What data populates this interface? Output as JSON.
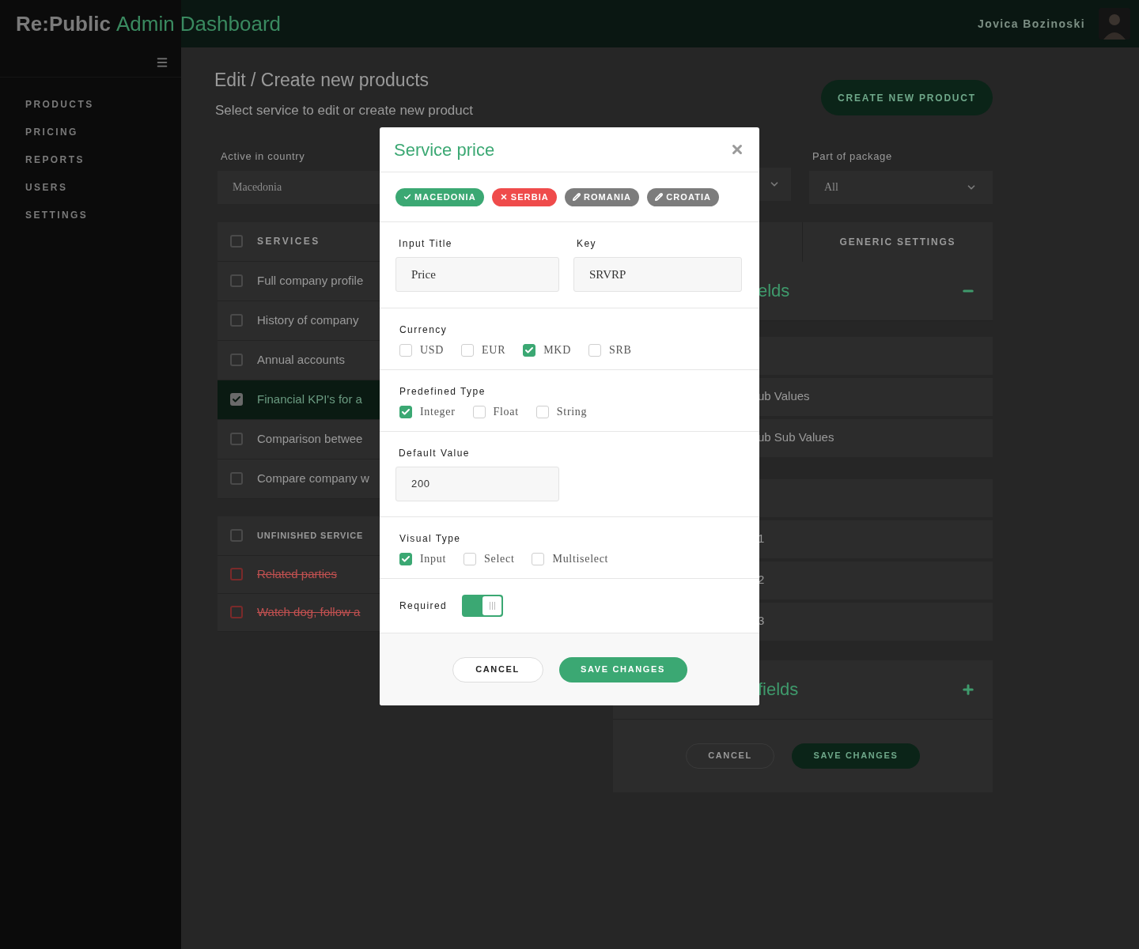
{
  "header": {
    "brand": "Re:Public",
    "brand_suffix": "Admin Dashboard",
    "user_name": "Jovica Bozinoski"
  },
  "sidebar": {
    "items": [
      {
        "label": "PRODUCTS"
      },
      {
        "label": "PRICING"
      },
      {
        "label": "REPORTS"
      },
      {
        "label": "USERS"
      },
      {
        "label": "SETTINGS"
      }
    ]
  },
  "page": {
    "title": "Edit / Create new products",
    "subtitle": "Select service to edit or create new product",
    "create_button": "CREATE NEW PRODUCT"
  },
  "filters": {
    "country": {
      "label": "Active in country",
      "value": "Macedonia"
    },
    "package": {
      "label": "Part of package",
      "value": "All"
    }
  },
  "services": {
    "header": "SERVICES",
    "header_checked": false,
    "rows": [
      {
        "label": "Full company profile",
        "checked": false,
        "selected": false
      },
      {
        "label": "History of company",
        "checked": false,
        "selected": false
      },
      {
        "label": "Annual accounts",
        "checked": false,
        "selected": false
      },
      {
        "label": "Financial KPI's for a",
        "checked": true,
        "selected": true
      },
      {
        "label": "Comparison betwee",
        "checked": false,
        "selected": false
      },
      {
        "label": "Compare company w",
        "checked": false,
        "selected": false
      }
    ]
  },
  "unfinished": {
    "header": "UNFINISHED SERVICE",
    "header_checked": false,
    "rows": [
      {
        "label": "Related parties",
        "checked": false
      },
      {
        "label": "Watch dog, follow a",
        "checked": false
      }
    ]
  },
  "settings_panel": {
    "tab": "GENERIC SETTINGS",
    "groups": [
      {
        "title": "elds",
        "expanded": true,
        "rows": [
          {
            "kind": "blank"
          },
          {
            "kind": "text",
            "text": "ub Values"
          },
          {
            "kind": "text",
            "text": "ub Sub Values"
          },
          {
            "kind": "gap"
          },
          {
            "kind": "blank"
          },
          {
            "kind": "text",
            "text": "1"
          },
          {
            "kind": "text",
            "text": "2"
          },
          {
            "kind": "text",
            "text": "3"
          }
        ]
      },
      {
        "title": "fields",
        "expanded": false
      }
    ],
    "cancel": "CANCEL",
    "save": "SAVE CHANGES"
  },
  "modal": {
    "title": "Service price",
    "countries": [
      {
        "label": "MACEDONIA",
        "kind": "done"
      },
      {
        "label": "SERBIA",
        "kind": "error"
      },
      {
        "label": "ROMANIA",
        "kind": "edit"
      },
      {
        "label": "CROATIA",
        "kind": "edit"
      }
    ],
    "input_title": {
      "label": "Input Title",
      "value": "Price"
    },
    "key": {
      "label": "Key",
      "value": "SRVRP"
    },
    "currency": {
      "label": "Currency",
      "options": [
        {
          "label": "USD",
          "checked": false
        },
        {
          "label": "EUR",
          "checked": false
        },
        {
          "label": "MKD",
          "checked": true
        },
        {
          "label": "SRB",
          "checked": false
        }
      ]
    },
    "predefined_type": {
      "label": "Predefined Type",
      "options": [
        {
          "label": "Integer",
          "checked": true
        },
        {
          "label": "Float",
          "checked": false
        },
        {
          "label": "String",
          "checked": false
        }
      ]
    },
    "default_value": {
      "label": "Default Value",
      "value": "200"
    },
    "visual_type": {
      "label": "Visual Type",
      "options": [
        {
          "label": "Input",
          "checked": true
        },
        {
          "label": "Select",
          "checked": false
        },
        {
          "label": "Multiselect",
          "checked": false
        }
      ]
    },
    "required": {
      "label": "Required",
      "on": true
    },
    "cancel": "CANCEL",
    "save": "SAVE CHANGES"
  }
}
